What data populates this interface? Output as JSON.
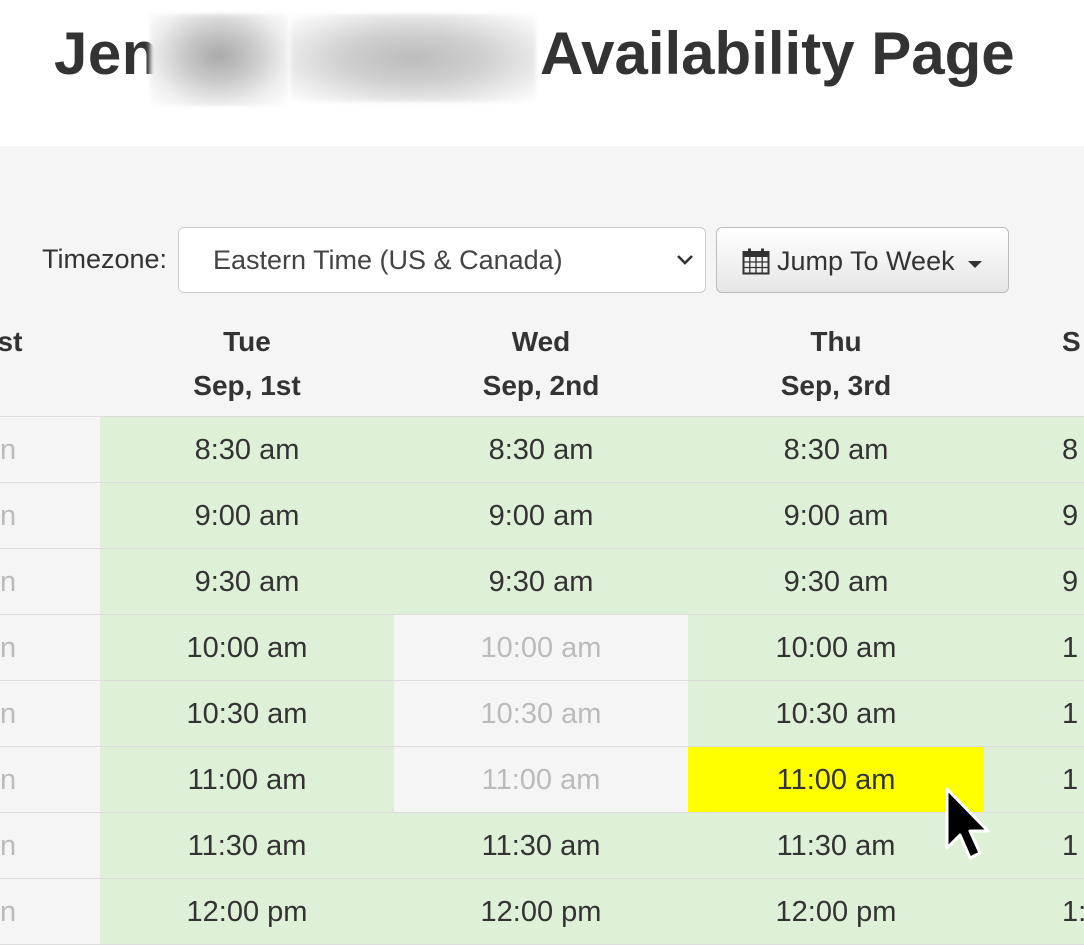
{
  "header": {
    "title_prefix": "Jen",
    "title_suffix": "Availability Page"
  },
  "toolbar": {
    "timezone_label": "Timezone:",
    "timezone_value": "Eastern Time (US & Canada)",
    "jump_label": "Jump To Week"
  },
  "columns": [
    {
      "day": "",
      "date": "st"
    },
    {
      "day": "Tue",
      "date": "Sep, 1st"
    },
    {
      "day": "Wed",
      "date": "Sep, 2nd"
    },
    {
      "day": "Thu",
      "date": "Sep, 3rd"
    },
    {
      "day": "",
      "date": "S"
    }
  ],
  "slots": {
    "left_partial": [
      "n",
      "n",
      "n",
      "n",
      "n",
      "n",
      "n",
      "n"
    ],
    "tue": [
      "8:30 am",
      "9:00 am",
      "9:30 am",
      "10:00 am",
      "10:30 am",
      "11:00 am",
      "11:30 am",
      "12:00 pm"
    ],
    "wed": [
      "8:30 am",
      "9:00 am",
      "9:30 am",
      "10:00 am",
      "10:30 am",
      "11:00 am",
      "11:30 am",
      "12:00 pm"
    ],
    "thu": [
      "8:30 am",
      "9:00 am",
      "9:30 am",
      "10:00 am",
      "10:30 am",
      "11:00 am",
      "11:30 am",
      "12:00 pm"
    ],
    "right_partial": [
      "8",
      "9",
      "9",
      "1",
      "1",
      "1",
      "1",
      "1:"
    ]
  },
  "colors": {
    "available": "#dff0d8",
    "unavailable": "#f5f5f5",
    "selected": "#ffff00"
  }
}
